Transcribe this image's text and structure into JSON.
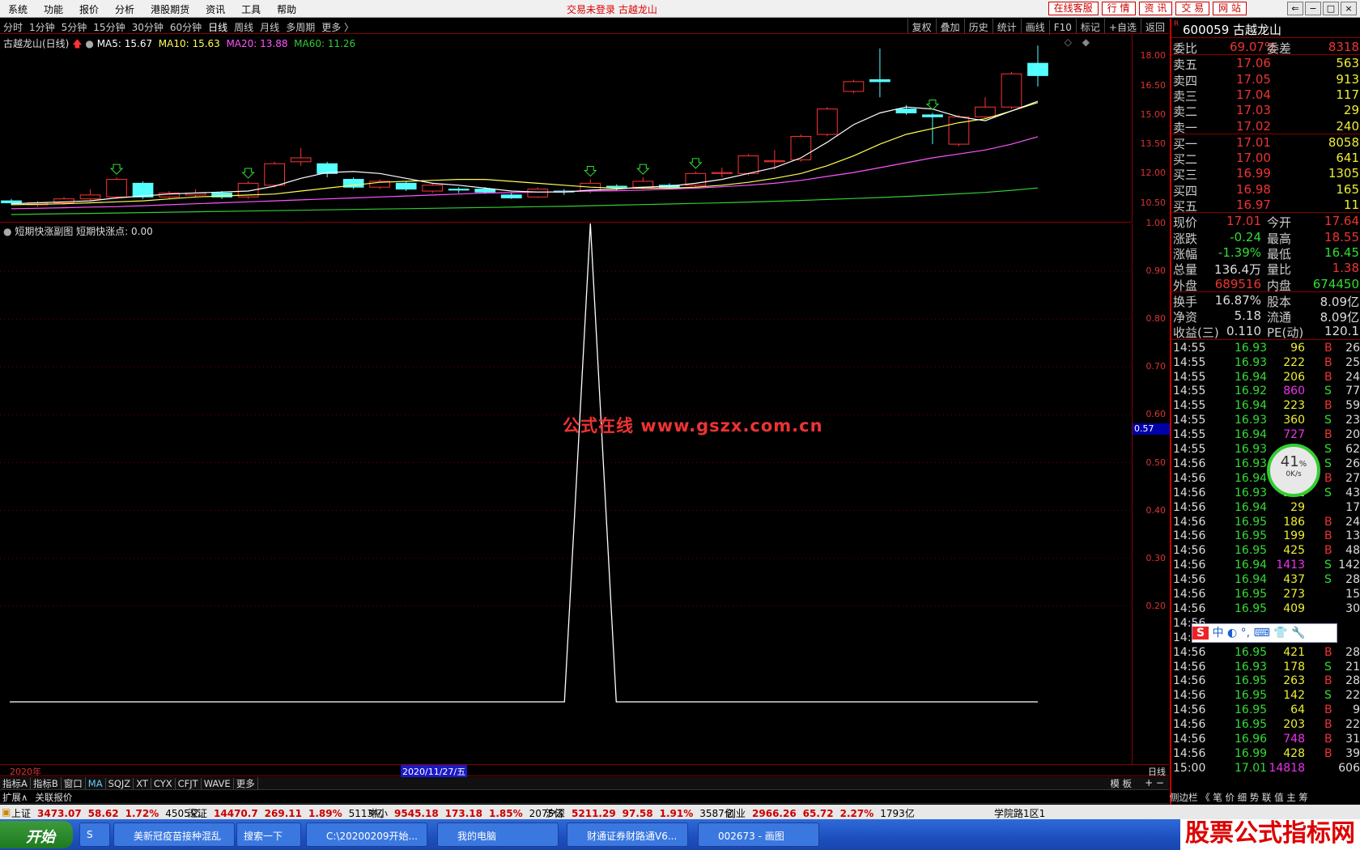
{
  "menubar": {
    "items": [
      "系统",
      "功能",
      "报价",
      "分析",
      "港股期货",
      "资讯",
      "工具",
      "帮助"
    ],
    "center_title": "交易未登录  古越龙山",
    "right_buttons": [
      "在线客服",
      "行 情",
      "资 讯",
      "交 易",
      "网 站"
    ]
  },
  "periodbar": {
    "periods": [
      "分时",
      "1分钟",
      "5分钟",
      "15分钟",
      "30分钟",
      "60分钟",
      "日线",
      "周线",
      "月线",
      "多周期",
      "更多 〉"
    ],
    "active": "日线",
    "tools": [
      "复权",
      "叠加",
      "历史",
      "统计",
      "画线",
      "F10",
      "标记",
      "+自选",
      "返回"
    ]
  },
  "main_chart": {
    "stock_label": "古越龙山(日线)",
    "ma5": "MA5: 15.67",
    "ma10": "MA10: 15.63",
    "ma20": "MA20: 13.88",
    "ma60": "MA60: 11.26",
    "price_ticks": [
      "18.00",
      "16.50",
      "15.00",
      "13.50",
      "12.00",
      "10.50"
    ],
    "colors": {
      "up": "#ff3333",
      "down": "#55ffff",
      "ma5": "#ffffff",
      "ma10": "#ffff55",
      "ma20": "#ff55ff",
      "ma60": "#33cc33"
    }
  },
  "chart_data": {
    "type": "candlestick",
    "title": "古越龙山(日线)",
    "ylim": [
      9.9,
      18.6
    ],
    "candles": [
      {
        "o": 10.6,
        "c": 10.5,
        "h": 10.7,
        "l": 10.4
      },
      {
        "o": 10.4,
        "c": 10.5,
        "h": 10.6,
        "l": 10.3
      },
      {
        "o": 10.5,
        "c": 10.7,
        "h": 10.8,
        "l": 10.4
      },
      {
        "o": 10.7,
        "c": 10.9,
        "h": 11.2,
        "l": 10.6
      },
      {
        "o": 10.8,
        "c": 11.7,
        "h": 11.8,
        "l": 10.7
      },
      {
        "o": 11.5,
        "c": 10.8,
        "h": 11.6,
        "l": 10.7
      },
      {
        "o": 10.8,
        "c": 11.0,
        "h": 11.1,
        "l": 10.7
      },
      {
        "o": 10.9,
        "c": 11.0,
        "h": 11.2,
        "l": 10.8
      },
      {
        "o": 11.0,
        "c": 10.8,
        "h": 11.1,
        "l": 10.7
      },
      {
        "o": 10.8,
        "c": 11.5,
        "h": 11.6,
        "l": 10.7
      },
      {
        "o": 11.4,
        "c": 12.5,
        "h": 12.6,
        "l": 11.3
      },
      {
        "o": 12.6,
        "c": 12.8,
        "h": 13.3,
        "l": 12.4
      },
      {
        "o": 12.5,
        "c": 12.0,
        "h": 12.6,
        "l": 11.8
      },
      {
        "o": 11.7,
        "c": 11.3,
        "h": 11.8,
        "l": 11.2
      },
      {
        "o": 11.3,
        "c": 11.6,
        "h": 11.7,
        "l": 11.2
      },
      {
        "o": 11.5,
        "c": 11.2,
        "h": 11.6,
        "l": 11.1
      },
      {
        "o": 11.1,
        "c": 11.4,
        "h": 11.5,
        "l": 11.0
      },
      {
        "o": 11.2,
        "c": 11.15,
        "h": 11.3,
        "l": 11.0
      },
      {
        "o": 11.2,
        "c": 11.05,
        "h": 11.3,
        "l": 10.95
      },
      {
        "o": 10.9,
        "c": 10.75,
        "h": 11.0,
        "l": 10.7
      },
      {
        "o": 10.8,
        "c": 11.2,
        "h": 11.3,
        "l": 10.75
      },
      {
        "o": 11.1,
        "c": 11.05,
        "h": 11.2,
        "l": 10.9
      },
      {
        "o": 11.1,
        "c": 11.5,
        "h": 11.7,
        "l": 11.0
      },
      {
        "o": 11.35,
        "c": 11.3,
        "h": 11.45,
        "l": 11.15
      },
      {
        "o": 11.3,
        "c": 11.6,
        "h": 11.8,
        "l": 11.2
      },
      {
        "o": 11.4,
        "c": 11.3,
        "h": 11.5,
        "l": 11.2
      },
      {
        "o": 11.4,
        "c": 12.0,
        "h": 12.1,
        "l": 11.3
      },
      {
        "o": 12.0,
        "c": 12.05,
        "h": 12.3,
        "l": 11.8
      },
      {
        "o": 12.0,
        "c": 12.9,
        "h": 13.0,
        "l": 11.9
      },
      {
        "o": 12.6,
        "c": 12.65,
        "h": 13.2,
        "l": 12.2
      },
      {
        "o": 12.7,
        "c": 13.9,
        "h": 14.0,
        "l": 12.6
      },
      {
        "o": 14.0,
        "c": 15.3,
        "h": 15.4,
        "l": 13.9
      },
      {
        "o": 16.2,
        "c": 16.7,
        "h": 16.8,
        "l": 16.1
      },
      {
        "o": 16.8,
        "c": 16.7,
        "h": 18.4,
        "l": 15.9
      },
      {
        "o": 15.3,
        "c": 15.1,
        "h": 15.5,
        "l": 15.0
      },
      {
        "o": 15.0,
        "c": 14.9,
        "h": 15.1,
        "l": 13.5
      },
      {
        "o": 13.5,
        "c": 14.9,
        "h": 15.0,
        "l": 13.4
      },
      {
        "o": 14.9,
        "c": 15.4,
        "h": 15.9,
        "l": 14.8
      },
      {
        "o": 15.4,
        "c": 17.1,
        "h": 17.2,
        "l": 15.3
      },
      {
        "o": 17.64,
        "c": 17.01,
        "h": 18.55,
        "l": 16.45
      }
    ],
    "buy_signal_bars": [
      4,
      9,
      22,
      24,
      26,
      35
    ],
    "ma5": [
      10.45,
      10.5,
      10.55,
      10.6,
      10.75,
      10.85,
      10.95,
      11.0,
      11.05,
      11.1,
      11.35,
      11.75,
      12.05,
      12.1,
      12.0,
      11.75,
      11.5,
      11.4,
      11.25,
      11.1,
      11.05,
      11.05,
      11.15,
      11.2,
      11.3,
      11.35,
      11.5,
      11.7,
      12.0,
      12.3,
      12.8,
      13.6,
      14.5,
      15.1,
      15.4,
      15.3,
      14.9,
      14.7,
      15.2,
      15.7
    ],
    "ma10": [
      10.4,
      10.42,
      10.45,
      10.5,
      10.55,
      10.6,
      10.7,
      10.8,
      10.85,
      10.9,
      10.95,
      11.1,
      11.25,
      11.4,
      11.55,
      11.6,
      11.65,
      11.7,
      11.7,
      11.6,
      11.5,
      11.4,
      11.3,
      11.25,
      11.25,
      11.25,
      11.3,
      11.4,
      11.55,
      11.75,
      12.0,
      12.4,
      12.9,
      13.5,
      14.0,
      14.3,
      14.6,
      14.8,
      15.2,
      15.63
    ],
    "ma20": [
      10.2,
      10.22,
      10.25,
      10.28,
      10.3,
      10.35,
      10.4,
      10.45,
      10.5,
      10.55,
      10.6,
      10.65,
      10.7,
      10.75,
      10.8,
      10.85,
      10.9,
      10.95,
      11.0,
      11.02,
      11.05,
      11.07,
      11.1,
      11.12,
      11.15,
      11.2,
      11.25,
      11.32,
      11.4,
      11.5,
      11.65,
      11.85,
      12.05,
      12.3,
      12.55,
      12.8,
      13.0,
      13.2,
      13.5,
      13.88
    ],
    "ma60": [
      9.9,
      9.92,
      9.94,
      9.96,
      9.98,
      10.0,
      10.02,
      10.04,
      10.06,
      10.08,
      10.1,
      10.12,
      10.14,
      10.16,
      10.18,
      10.2,
      10.22,
      10.24,
      10.26,
      10.28,
      10.3,
      10.32,
      10.35,
      10.38,
      10.41,
      10.44,
      10.47,
      10.5,
      10.54,
      10.58,
      10.62,
      10.67,
      10.72,
      10.77,
      10.83,
      10.89,
      10.96,
      11.03,
      11.14,
      11.26
    ],
    "sub": {
      "title": "短期快涨副图",
      "value_label": "短期快涨点: 0.00",
      "ticks": [
        "1.00",
        "0.90",
        "0.80",
        "0.70",
        "0.60",
        "0.50",
        "0.40",
        "0.30",
        "0.20"
      ],
      "ylim": [
        0,
        1
      ],
      "cursor_value": "0.57",
      "spike_bar": 22,
      "spike_value": 1.0
    }
  },
  "date_row": {
    "year": "2020年",
    "cursor_date": "2020/11/27/五",
    "period": "日线"
  },
  "index_tabs": [
    "指标A",
    "指标B",
    "窗口",
    "MA",
    "SQJZ",
    "XT",
    "CYX",
    "CFJT",
    "WAVE",
    "更多"
  ],
  "index_tabs_right": "模 板",
  "plus_minus": "+  −",
  "ext_row": [
    "扩展∧",
    "关联报价"
  ],
  "right_panel": {
    "code_flag": "R",
    "code_name": "600059 古越龙山",
    "webi": {
      "label": "委比",
      "value": "69.07%",
      "diff_label": "委差",
      "diff": "8318"
    },
    "asks": [
      {
        "label": "卖五",
        "price": "17.06",
        "vol": "563"
      },
      {
        "label": "卖四",
        "price": "17.05",
        "vol": "913"
      },
      {
        "label": "卖三",
        "price": "17.04",
        "vol": "117"
      },
      {
        "label": "卖二",
        "price": "17.03",
        "vol": "29"
      },
      {
        "label": "卖一",
        "price": "17.02",
        "vol": "240"
      }
    ],
    "bids": [
      {
        "label": "买一",
        "price": "17.01",
        "vol": "8058"
      },
      {
        "label": "买二",
        "price": "17.00",
        "vol": "641"
      },
      {
        "label": "买三",
        "price": "16.99",
        "vol": "1305"
      },
      {
        "label": "买四",
        "price": "16.98",
        "vol": "165"
      },
      {
        "label": "买五",
        "price": "16.97",
        "vol": "11"
      }
    ],
    "quote": [
      {
        "l1": "现价",
        "v1": "17.01",
        "c1": "red",
        "l2": "今开",
        "v2": "17.64",
        "c2": "red"
      },
      {
        "l1": "涨跌",
        "v1": "-0.24",
        "c1": "grn",
        "l2": "最高",
        "v2": "18.55",
        "c2": "red"
      },
      {
        "l1": "涨幅",
        "v1": "-1.39%",
        "c1": "grn",
        "l2": "最低",
        "v2": "16.45",
        "c2": "grn"
      },
      {
        "l1": "总量",
        "v1": "136.4万",
        "c1": "wht",
        "l2": "量比",
        "v2": "1.38",
        "c2": "red"
      },
      {
        "l1": "外盘",
        "v1": "689516",
        "c1": "red",
        "l2": "内盘",
        "v2": "674450",
        "c2": "grn"
      }
    ],
    "fund": [
      {
        "l1": "换手",
        "v1": "16.87%",
        "l2": "股本",
        "v2": "8.09亿"
      },
      {
        "l1": "净资",
        "v1": "5.18",
        "l2": "流通",
        "v2": "8.09亿"
      },
      {
        "l1": "收益(三)",
        "v1": "0.110",
        "l2": "PE(动)",
        "v2": "120.1"
      }
    ],
    "ticks": [
      {
        "t": "14:55",
        "p": "16.93",
        "v": "96",
        "vc": "yel",
        "bs": "B",
        "n": "26"
      },
      {
        "t": "14:55",
        "p": "16.93",
        "v": "222",
        "vc": "yel",
        "bs": "B",
        "n": "25"
      },
      {
        "t": "14:55",
        "p": "16.94",
        "v": "206",
        "vc": "yel",
        "bs": "B",
        "n": "24"
      },
      {
        "t": "14:55",
        "p": "16.92",
        "v": "860",
        "vc": "mag",
        "bs": "S",
        "n": "77"
      },
      {
        "t": "14:55",
        "p": "16.94",
        "v": "223",
        "vc": "yel",
        "bs": "B",
        "n": "59"
      },
      {
        "t": "14:55",
        "p": "16.93",
        "v": "360",
        "vc": "yel",
        "bs": "S",
        "n": "23"
      },
      {
        "t": "14:55",
        "p": "16.94",
        "v": "727",
        "vc": "mag",
        "bs": "B",
        "n": "20"
      },
      {
        "t": "14:55",
        "p": "16.93",
        "v": "",
        "vc": "yel",
        "bs": "S",
        "n": "62"
      },
      {
        "t": "14:56",
        "p": "16.93",
        "v": "",
        "vc": "yel",
        "bs": "S",
        "n": "26"
      },
      {
        "t": "14:56",
        "p": "16.94",
        "v": "",
        "vc": "yel",
        "bs": "B",
        "n": "27"
      },
      {
        "t": "14:56",
        "p": "16.93",
        "v": "201",
        "vc": "yel",
        "bs": "S",
        "n": "43"
      },
      {
        "t": "14:56",
        "p": "16.94",
        "v": "29",
        "vc": "yel",
        "bs": "",
        "n": "17"
      },
      {
        "t": "14:56",
        "p": "16.95",
        "v": "186",
        "vc": "yel",
        "bs": "B",
        "n": "24"
      },
      {
        "t": "14:56",
        "p": "16.95",
        "v": "199",
        "vc": "yel",
        "bs": "B",
        "n": "13"
      },
      {
        "t": "14:56",
        "p": "16.95",
        "v": "425",
        "vc": "yel",
        "bs": "B",
        "n": "48"
      },
      {
        "t": "14:56",
        "p": "16.94",
        "v": "1413",
        "vc": "mag",
        "bs": "S",
        "n": "142"
      },
      {
        "t": "14:56",
        "p": "16.94",
        "v": "437",
        "vc": "yel",
        "bs": "S",
        "n": "28"
      },
      {
        "t": "14:56",
        "p": "16.95",
        "v": "273",
        "vc": "yel",
        "bs": "",
        "n": "15"
      },
      {
        "t": "14:56",
        "p": "16.95",
        "v": "409",
        "vc": "yel",
        "bs": "",
        "n": "30"
      },
      {
        "t": "14:56",
        "p": "",
        "v": "",
        "vc": "yel",
        "bs": "",
        "n": ""
      },
      {
        "t": "14:56",
        "p": "",
        "v": "",
        "vc": "yel",
        "bs": "",
        "n": ""
      },
      {
        "t": "14:56",
        "p": "16.95",
        "v": "421",
        "vc": "yel",
        "bs": "B",
        "n": "28"
      },
      {
        "t": "14:56",
        "p": "16.93",
        "v": "178",
        "vc": "yel",
        "bs": "S",
        "n": "21"
      },
      {
        "t": "14:56",
        "p": "16.95",
        "v": "263",
        "vc": "yel",
        "bs": "B",
        "n": "28"
      },
      {
        "t": "14:56",
        "p": "16.95",
        "v": "142",
        "vc": "yel",
        "bs": "S",
        "n": "22"
      },
      {
        "t": "14:56",
        "p": "16.95",
        "v": "64",
        "vc": "yel",
        "bs": "B",
        "n": "9"
      },
      {
        "t": "14:56",
        "p": "16.95",
        "v": "203",
        "vc": "yel",
        "bs": "B",
        "n": "22"
      },
      {
        "t": "14:56",
        "p": "16.96",
        "v": "748",
        "vc": "mag",
        "bs": "B",
        "n": "31"
      },
      {
        "t": "14:56",
        "p": "16.99",
        "v": "428",
        "vc": "yel",
        "bs": "B",
        "n": "39"
      },
      {
        "t": "15:00",
        "p": "17.01",
        "v": "14818",
        "vc": "mag",
        "bs": "",
        "n": "606"
      }
    ],
    "side_tabs": "侧边栏 《   笔  价  细  势  联  值  主  筹"
  },
  "netbadge": {
    "pct": "41",
    "unit": "%",
    "speed": "0K/s"
  },
  "ime": "中 ◐ °, ⌨ 👕 🔧",
  "status": {
    "items": [
      {
        "name": "上证",
        "v": "3473.07",
        "chg": "58.62",
        "pct": "1.72%",
        "amt": "4505亿"
      },
      {
        "name": "深证",
        "v": "14470.7",
        "chg": "269.11",
        "pct": "1.89%",
        "amt": "5113亿"
      },
      {
        "name": "中小",
        "v": "9545.18",
        "chg": "173.18",
        "pct": "1.85%",
        "amt": "2075亿"
      },
      {
        "name": "沪深",
        "v": "5211.29",
        "chg": "97.58",
        "pct": "1.91%",
        "amt": "3587亿"
      },
      {
        "name": "创业",
        "v": "2966.26",
        "chg": "65.72",
        "pct": "2.27%",
        "amt": "1793亿"
      }
    ],
    "location": "学院路1区1"
  },
  "watermark": "公式在线  www.gszx.com.cn",
  "watermark2": "股票公式指标网",
  "watermark3": "www.gszx.com.cn",
  "taskbar": {
    "start": "开始",
    "tasks": [
      "美新冠疫苗接种混乱",
      "搜索一下",
      "C:\\20200209开始...",
      "我的电脑",
      "财通证券财路通V6...",
      "002673 - 画图"
    ]
  }
}
